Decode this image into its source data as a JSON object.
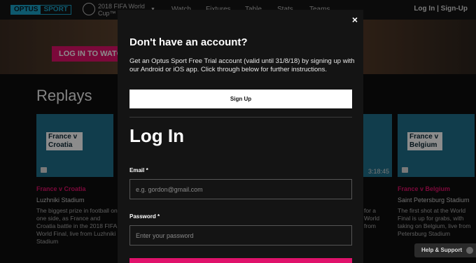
{
  "nav": {
    "logo_left": "OPTUS",
    "logo_right": "SPORT",
    "competition": "2018 FIFA World Cup™",
    "links": [
      "Watch",
      "Fixtures",
      "Table",
      "Stats",
      "Teams"
    ],
    "login_signup": "Log In | Sign-Up"
  },
  "hero": {
    "button": "LOG IN TO WATCH"
  },
  "replays": {
    "heading": "Replays",
    "cards": [
      {
        "thumb_title": "France v Croatia",
        "red_title": "France v Croatia",
        "venue": "Luzhniki Stadium",
        "desc": "The biggest prize in football on one side, as France and Croatia battle in the 2018 FIFA World Final, live from Luzhniki Stadium"
      },
      {
        "duration": "3:18:45",
        "desc_partial": "for a World from"
      },
      {
        "thumb_title": "France v Belgium",
        "red_title": "France v Belgium",
        "venue": "Saint Petersburg Stadium",
        "desc": "The first shot at the World Final is up for grabs, with taking on Belgium, live from Petersburg Stadium"
      }
    ]
  },
  "help": {
    "label": "Help & Support"
  },
  "modal": {
    "close": "×",
    "no_account_heading": "Don't have an account?",
    "trial_text": "Get an Optus Sport Free Trial account (valid until 31/8/18) by signing up with our Android or iOS app. Click through below for further instructions.",
    "signup_button": "Sign Up",
    "login_heading": "Log In",
    "email_label": "Email *",
    "email_placeholder": "e.g. gordon@gmail.com",
    "password_label": "Password *",
    "password_placeholder": "Enter your password"
  },
  "colors": {
    "accent": "#e0126b",
    "brand": "#1aa3c9"
  }
}
